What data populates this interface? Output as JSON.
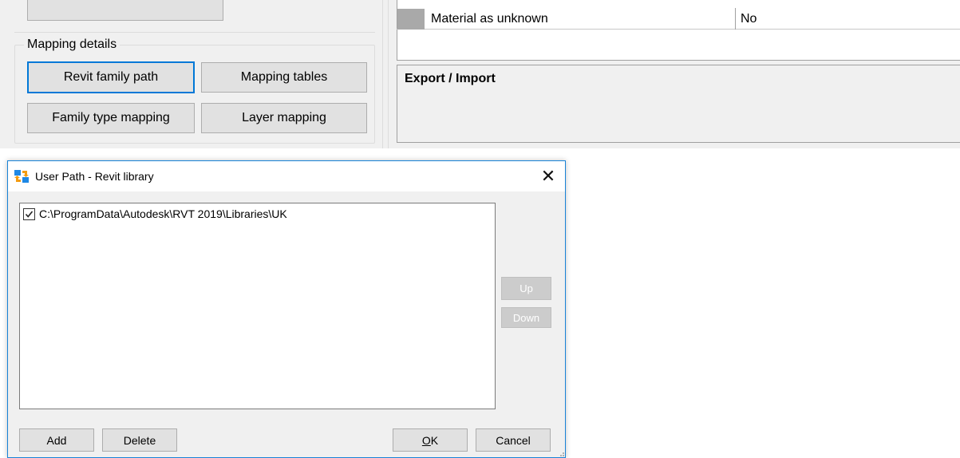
{
  "main_window": {
    "mapping_group": {
      "title": "Mapping details",
      "revit_family_path_label": "Revit family path",
      "mapping_tables_label": "Mapping tables",
      "family_type_mapping_label": "Family type mapping",
      "layer_mapping_label": "Layer mapping"
    },
    "properties": {
      "row_name": "Material as unknown",
      "row_value": "No"
    },
    "export_section_title": "Export / Import"
  },
  "dialog": {
    "title": "User Path - Revit library",
    "close_glyph": "✕",
    "paths": [
      {
        "checked": true,
        "path": "C:\\ProgramData\\Autodesk\\RVT 2019\\Libraries\\UK"
      }
    ],
    "up_label": "Up",
    "down_label": "Down",
    "add_label": "Add",
    "delete_label": "Delete",
    "ok_mnemonic": "O",
    "ok_rest": "K",
    "cancel_label": "Cancel"
  },
  "colors": {
    "window_bg": "#f0f0f0",
    "focus_border": "#0078d7",
    "dialog_border": "#1883d7",
    "button_face": "#e1e1e1",
    "disabled_button": "#cccccc",
    "icon_blue": "#1e88e5",
    "icon_orange": "#f39c12"
  },
  "icons": {
    "app_icon": "revit-sync-arrows-icon",
    "close": "close-icon",
    "checkbox": "checkmark-icon",
    "grip": "resize-grip-icon"
  }
}
